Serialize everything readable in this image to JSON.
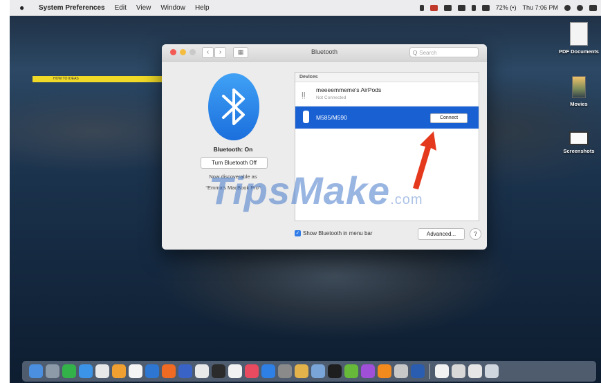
{
  "menubar": {
    "app_name": "System Preferences",
    "items": [
      "Edit",
      "View",
      "Window",
      "Help"
    ],
    "battery": "72% (•)",
    "clock": "Thu 7:06 PM"
  },
  "desktop": {
    "strip_text": "HOW TO IDEAS",
    "icons": [
      {
        "label": "PDF Documents",
        "icon": "document-icon"
      },
      {
        "label": "Movies",
        "icon": "movie-icon"
      },
      {
        "label": "Screenshots",
        "icon": "screenshot-icon"
      }
    ]
  },
  "window": {
    "title": "Bluetooth",
    "search_placeholder": "Search",
    "bluetooth_status": "Bluetooth: On",
    "toggle_button": "Turn Bluetooth Off",
    "discoverable_text": "Now discoverable as",
    "device_name": "“Emma's MacBook Pro”",
    "devices_header": "Devices",
    "devices": [
      {
        "name": "meeeemmeme's AirPods",
        "status": "Not Connected",
        "icon": "airpods-icon"
      },
      {
        "name": "M585/M590",
        "action": "Connect",
        "icon": "mouse-icon",
        "selected": true
      }
    ],
    "show_in_menu_bar": "Show Bluetooth in menu bar",
    "advanced_button": "Advanced...",
    "help_button": "?"
  },
  "watermark": {
    "main": "TipsMake",
    "tld": ".com"
  },
  "colors": {
    "selection": "#1961d3",
    "bluetooth_blue": "#2b86ec",
    "arrow_red": "#e5391e",
    "highlight_yellow": "#f1da27"
  }
}
